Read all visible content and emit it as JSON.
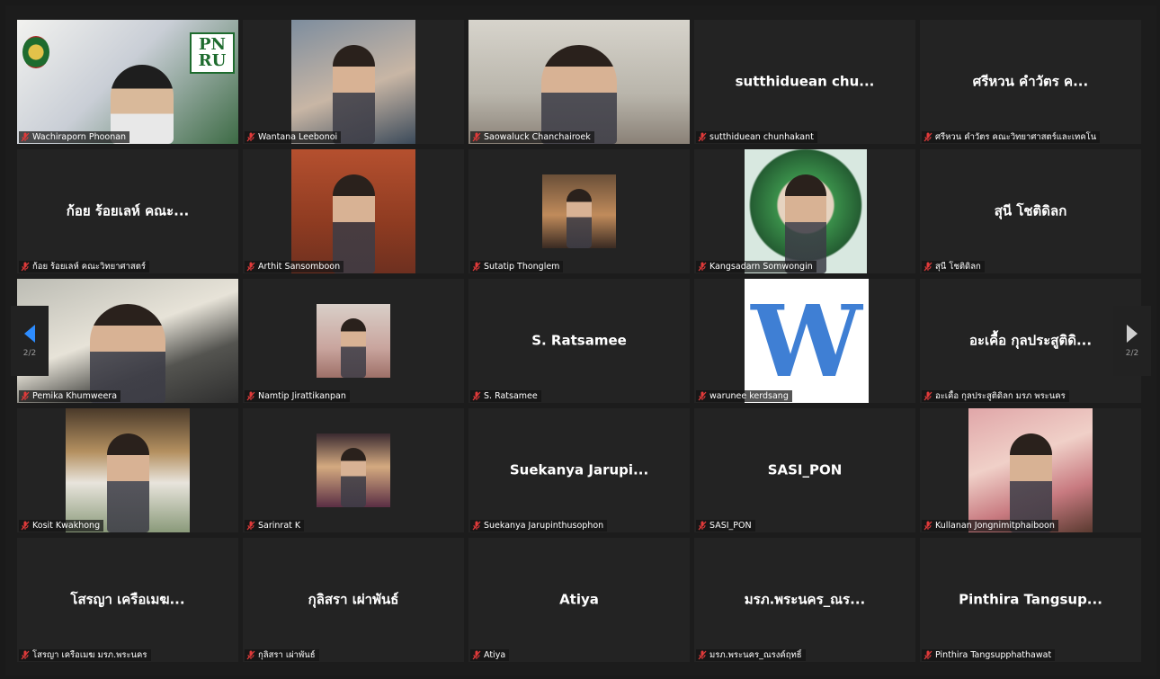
{
  "page_indicator": "2/2",
  "colors": {
    "muted_mic": "#e03a3a",
    "arrow_left": "#2d8cff",
    "arrow_right": "#cfcfcf"
  },
  "tiles": [
    {
      "name": "Wachiraporn Phoonan",
      "display": "",
      "kind": "video-logo",
      "logo_text_1": "PN",
      "logo_text_2": "RU"
    },
    {
      "name": "Wantana Leebonoi",
      "display": "",
      "kind": "video"
    },
    {
      "name": "Saowaluck Chanchairoek",
      "display": "",
      "kind": "video"
    },
    {
      "name": "sutthiduean chunhakant",
      "display": "sutthiduean chu...",
      "kind": "name"
    },
    {
      "name": "ศรีหวน คำวัตร คณะวิทยาศาสตร์และเทคโน",
      "display": "ศรีหวน คำวัตร ค...",
      "kind": "name"
    },
    {
      "name": "ก้อย ร้อยเลห์ คณะวิทยาศาสตร์",
      "display": "ก้อย ร้อยเลห์ คณะ...",
      "kind": "name"
    },
    {
      "name": "Arthit Sansomboon",
      "display": "",
      "kind": "photo"
    },
    {
      "name": "Sutatip Thonglem",
      "display": "",
      "kind": "photo"
    },
    {
      "name": "Kangsadarn Somwongin",
      "display": "",
      "kind": "photo"
    },
    {
      "name": "สุนี โชติดิลก",
      "display": "สุนี โชติดิลก",
      "kind": "name"
    },
    {
      "name": "Pemika Khumweera",
      "display": "",
      "kind": "video"
    },
    {
      "name": "Namtip Jirattikanpan",
      "display": "",
      "kind": "photo"
    },
    {
      "name": "S. Ratsamee",
      "display": "S. Ratsamee",
      "kind": "name"
    },
    {
      "name": "warunee kerdsang",
      "display": "",
      "kind": "letter",
      "letter": "W"
    },
    {
      "name": "อะเคื้อ กุลประสูติดิลก มรภ พระนคร",
      "display": "อะเคื้อ กุลประสูติดิ...",
      "kind": "name"
    },
    {
      "name": "Kosit Kwakhong",
      "display": "",
      "kind": "photo"
    },
    {
      "name": "Sarinrat K",
      "display": "",
      "kind": "photo"
    },
    {
      "name": "Suekanya Jarupinthusophon",
      "display": "Suekanya Jarupi...",
      "kind": "name"
    },
    {
      "name": "SASI_PON",
      "display": "SASI_PON",
      "kind": "name"
    },
    {
      "name": "Kullanan Jongnimitphaiboon",
      "display": "",
      "kind": "photo"
    },
    {
      "name": "โสรญา เครือเมฆ มรภ.พระนคร",
      "display": "โสรญา เครือเมฆ...",
      "kind": "name"
    },
    {
      "name": "กุลิสรา เผ่าพันธ์",
      "display": "กุลิสรา เผ่าพันธ์",
      "kind": "name"
    },
    {
      "name": "Atiya",
      "display": "Atiya",
      "kind": "name"
    },
    {
      "name": "มรภ.พระนคร_ณรงค์ฤทธิ์",
      "display": "มรภ.พระนคร_ณร...",
      "kind": "name"
    },
    {
      "name": "Pinthira Tangsupphathawat",
      "display": "Pinthira Tangsup...",
      "kind": "name"
    }
  ]
}
